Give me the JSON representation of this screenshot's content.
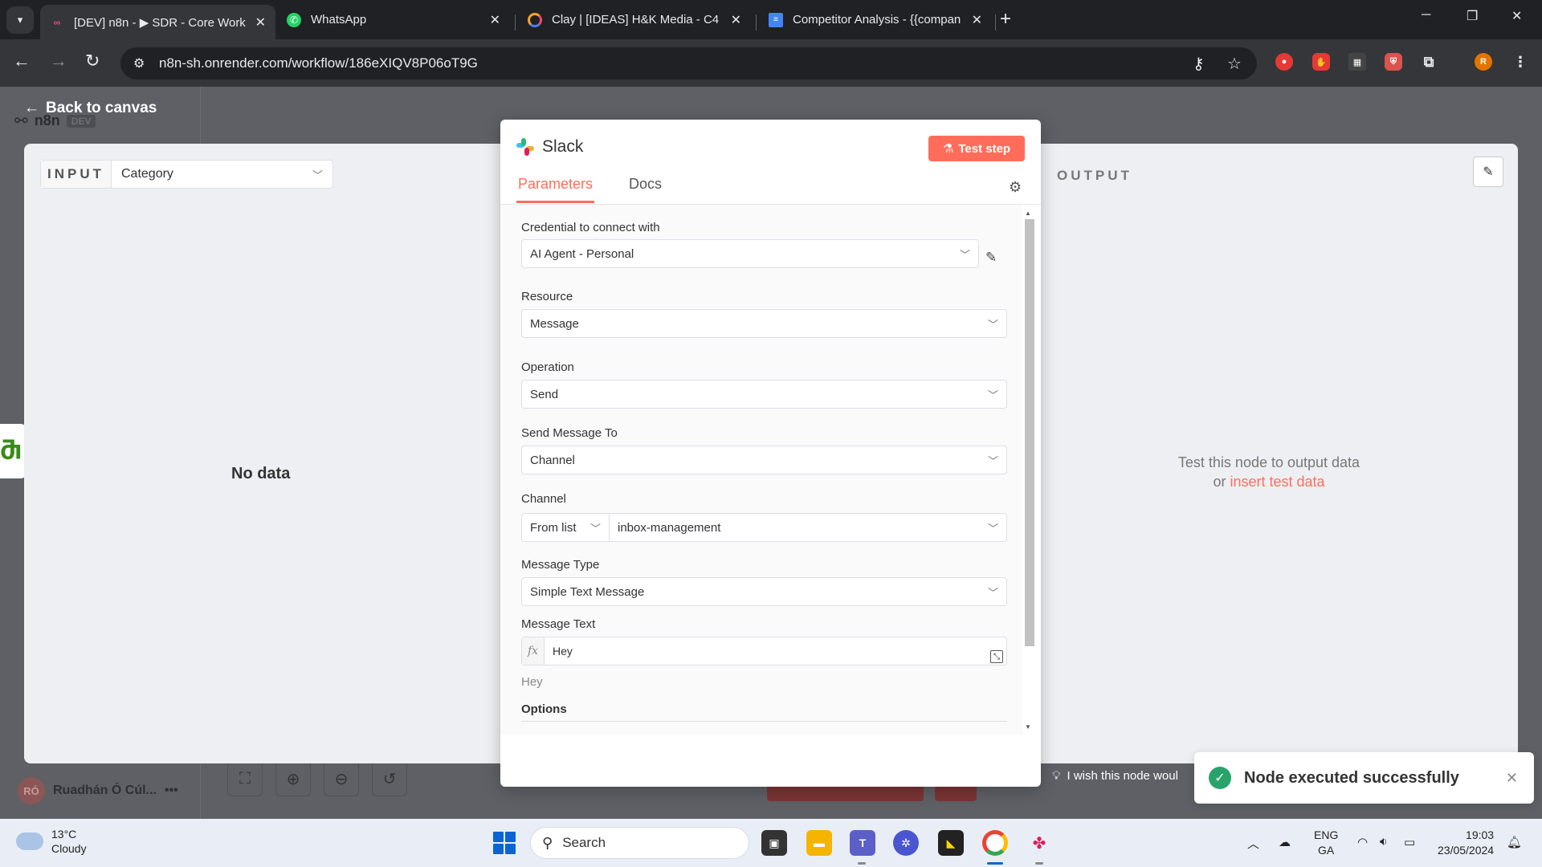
{
  "browser": {
    "tabs": [
      {
        "title": "[DEV] n8n - ▶ SDR - Core Work",
        "favicon": "n8n-icon",
        "active": true
      },
      {
        "title": "WhatsApp",
        "favicon": "whatsapp-icon",
        "active": false
      },
      {
        "title": "Clay | [IDEAS] H&K Media - C4",
        "favicon": "clay-icon",
        "active": false
      },
      {
        "title": "Competitor Analysis - {{compan",
        "favicon": "docs-icon",
        "active": false
      }
    ],
    "url": "n8n-sh.onrender.com/workflow/186eXIQV8P06oT9G",
    "profile_initial": "R",
    "ext_badge": "R"
  },
  "app": {
    "brand": "n8n",
    "env_badge": "DEV",
    "back_label": "Back to canvas",
    "user_initials": "RÓ",
    "user_name": "Ruadhán Ó Cúl...",
    "wish_text": "I wish this node woul"
  },
  "ndv": {
    "input": {
      "label": "INPUT",
      "select_value": "Category",
      "empty_text": "No data"
    },
    "output": {
      "label": "OUTPUT",
      "empty_line1": "Test this node to output data",
      "empty_or": "or",
      "empty_link": "insert test data"
    },
    "node": {
      "name": "Slack",
      "test_label": "Test step",
      "tabs": [
        "Parameters",
        "Docs"
      ],
      "fields": {
        "credential_label": "Credential to connect with",
        "credential_value": "AI Agent - Personal",
        "resource_label": "Resource",
        "resource_value": "Message",
        "operation_label": "Operation",
        "operation_value": "Send",
        "send_to_label": "Send Message To",
        "send_to_value": "Channel",
        "channel_label": "Channel",
        "channel_mode": "From list",
        "channel_value": "inbox-management",
        "msg_type_label": "Message Type",
        "msg_type_value": "Simple Text Message",
        "msg_text_label": "Message Text",
        "msg_text_value": "Hey",
        "msg_text_preview": "Hey",
        "options_label": "Options"
      }
    }
  },
  "toast": {
    "message": "Node executed successfully"
  },
  "taskbar": {
    "temp": "13°C",
    "condition": "Cloudy",
    "search_placeholder": "Search",
    "lang_line1": "ENG",
    "lang_line2": "GA",
    "time": "19:03",
    "date": "23/05/2024"
  },
  "colors": {
    "accent": "#ff6d5a",
    "success": "#29a36a"
  }
}
